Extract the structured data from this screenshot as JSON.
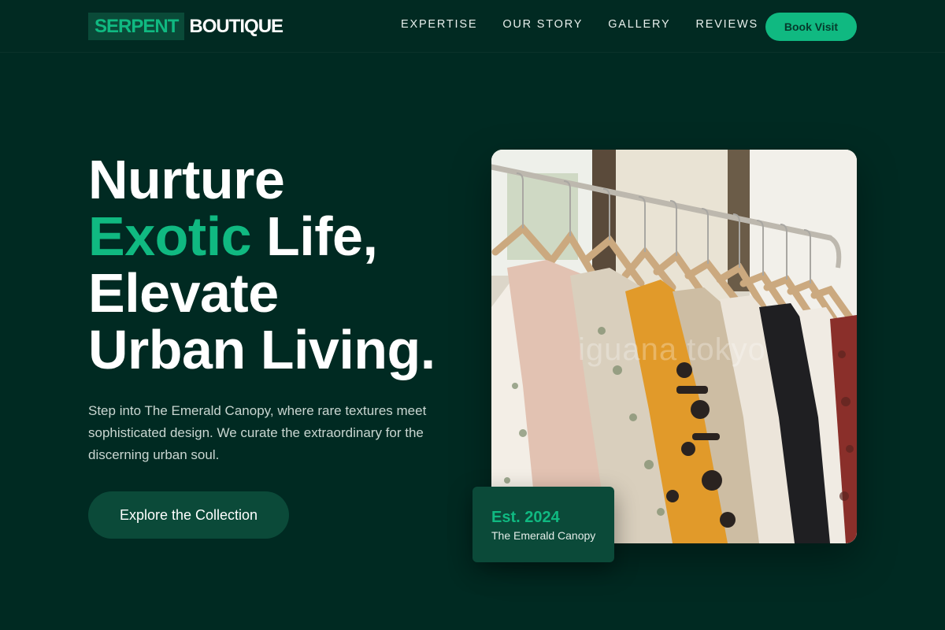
{
  "header": {
    "logo_highlight": "SERPENT",
    "logo_rest": "BOUTIQUE",
    "nav": [
      "EXPERTISE",
      "OUR STORY",
      "GALLERY",
      "REVIEWS"
    ],
    "cta_label": "Book Visit"
  },
  "hero": {
    "headline_line1": "Nurture",
    "headline_accent": "Exotic",
    "headline_line2_rest": " Life,",
    "headline_line3": "Elevate",
    "headline_line4": "Urban Living.",
    "subtext": "Step into The Emerald Canopy, where rare textures meet sophisticated design. We curate the extraordinary for the discerning urban soul.",
    "cta_label": "Explore the Collection"
  },
  "image": {
    "watermark": "iguana tokyo"
  },
  "badge": {
    "year": "Est. 2024",
    "place": "The Emerald Canopy"
  },
  "colors": {
    "background": "#002a22",
    "accent": "#10b981",
    "panel": "#0b4a39"
  }
}
